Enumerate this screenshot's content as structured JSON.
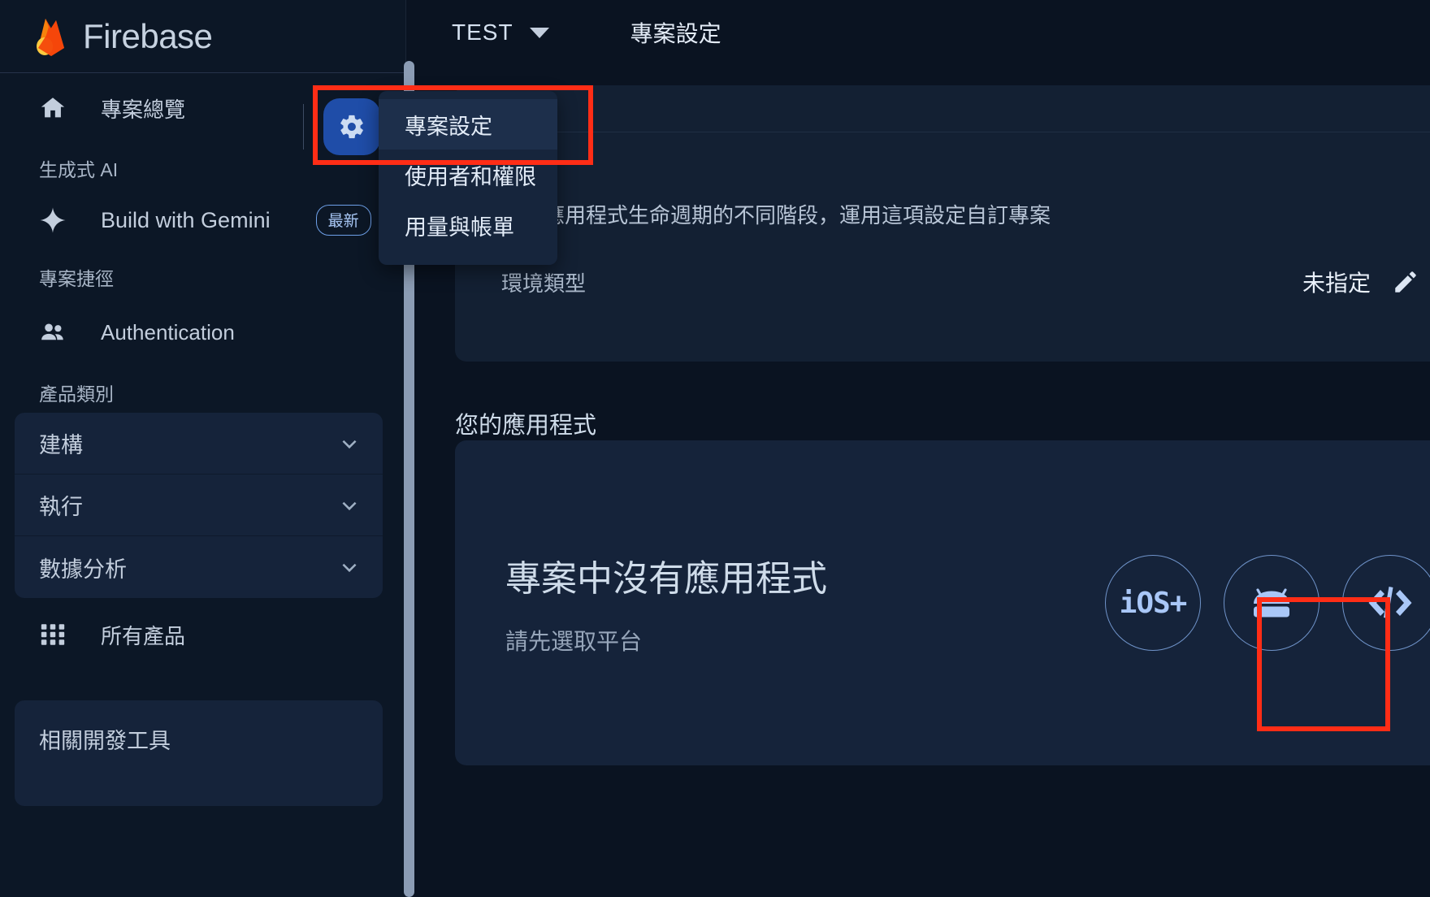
{
  "brand": {
    "name": "Firebase",
    "logo_icon": "firebase-flame-icon"
  },
  "topbar": {
    "project_name": "TEST",
    "project_caret_icon": "chevron-down-icon",
    "breadcrumb": "專案設定"
  },
  "sidebar": {
    "project_overview": {
      "label": "專案總覽",
      "icon": "home-icon"
    },
    "gear_button": {
      "icon": "gear-icon",
      "tooltip": "專案設定"
    },
    "sections": [
      {
        "label": "生成式 AI"
      },
      {
        "label": "專案捷徑"
      },
      {
        "label": "產品類別"
      }
    ],
    "gemini": {
      "label": "Build with Gemini",
      "icon": "sparkle-icon",
      "badge": "最新"
    },
    "authentication": {
      "label": "Authentication",
      "icon": "people-icon"
    },
    "accordions": [
      {
        "label": "建構",
        "icon": "chevron-down-icon"
      },
      {
        "label": "執行",
        "icon": "chevron-down-icon"
      },
      {
        "label": "數據分析",
        "icon": "chevron-down-icon"
      }
    ],
    "all_products": {
      "label": "所有產品",
      "icon": "grid-apps-icon"
    },
    "dev_tools": {
      "label": "相關開發工具"
    }
  },
  "settings_menu": {
    "items": [
      {
        "label": "專案設定",
        "active": true
      },
      {
        "label": "使用者和權限",
        "active": false
      },
      {
        "label": "用量與帳單",
        "active": false
      }
    ]
  },
  "main": {
    "description": "按照應用程式生命週期的不同階段，運用這項設定自訂專案",
    "environment_row": {
      "label": "環境類型",
      "value": "未指定",
      "edit_icon": "pencil-icon"
    },
    "apps_section": {
      "title": "您的應用程式",
      "empty_heading": "專案中沒有應用程式",
      "empty_subtitle": "請先選取平台",
      "platforms": [
        {
          "name": "ios",
          "label": "iOS+",
          "icon": "apple-ios-icon"
        },
        {
          "name": "android",
          "label": "",
          "icon": "android-robot-icon"
        },
        {
          "name": "web",
          "label": "",
          "icon": "code-brackets-icon"
        }
      ]
    }
  },
  "annotations": {
    "highlight_color": "#ff2d16",
    "boxes": [
      {
        "name": "project-settings-menu-item"
      },
      {
        "name": "web-platform-button"
      }
    ]
  },
  "colors": {
    "accent_blue": "#1f4da8",
    "page_bg": "#0a1321",
    "panel_bg": "#15233a",
    "text_primary": "#cfdcea"
  }
}
